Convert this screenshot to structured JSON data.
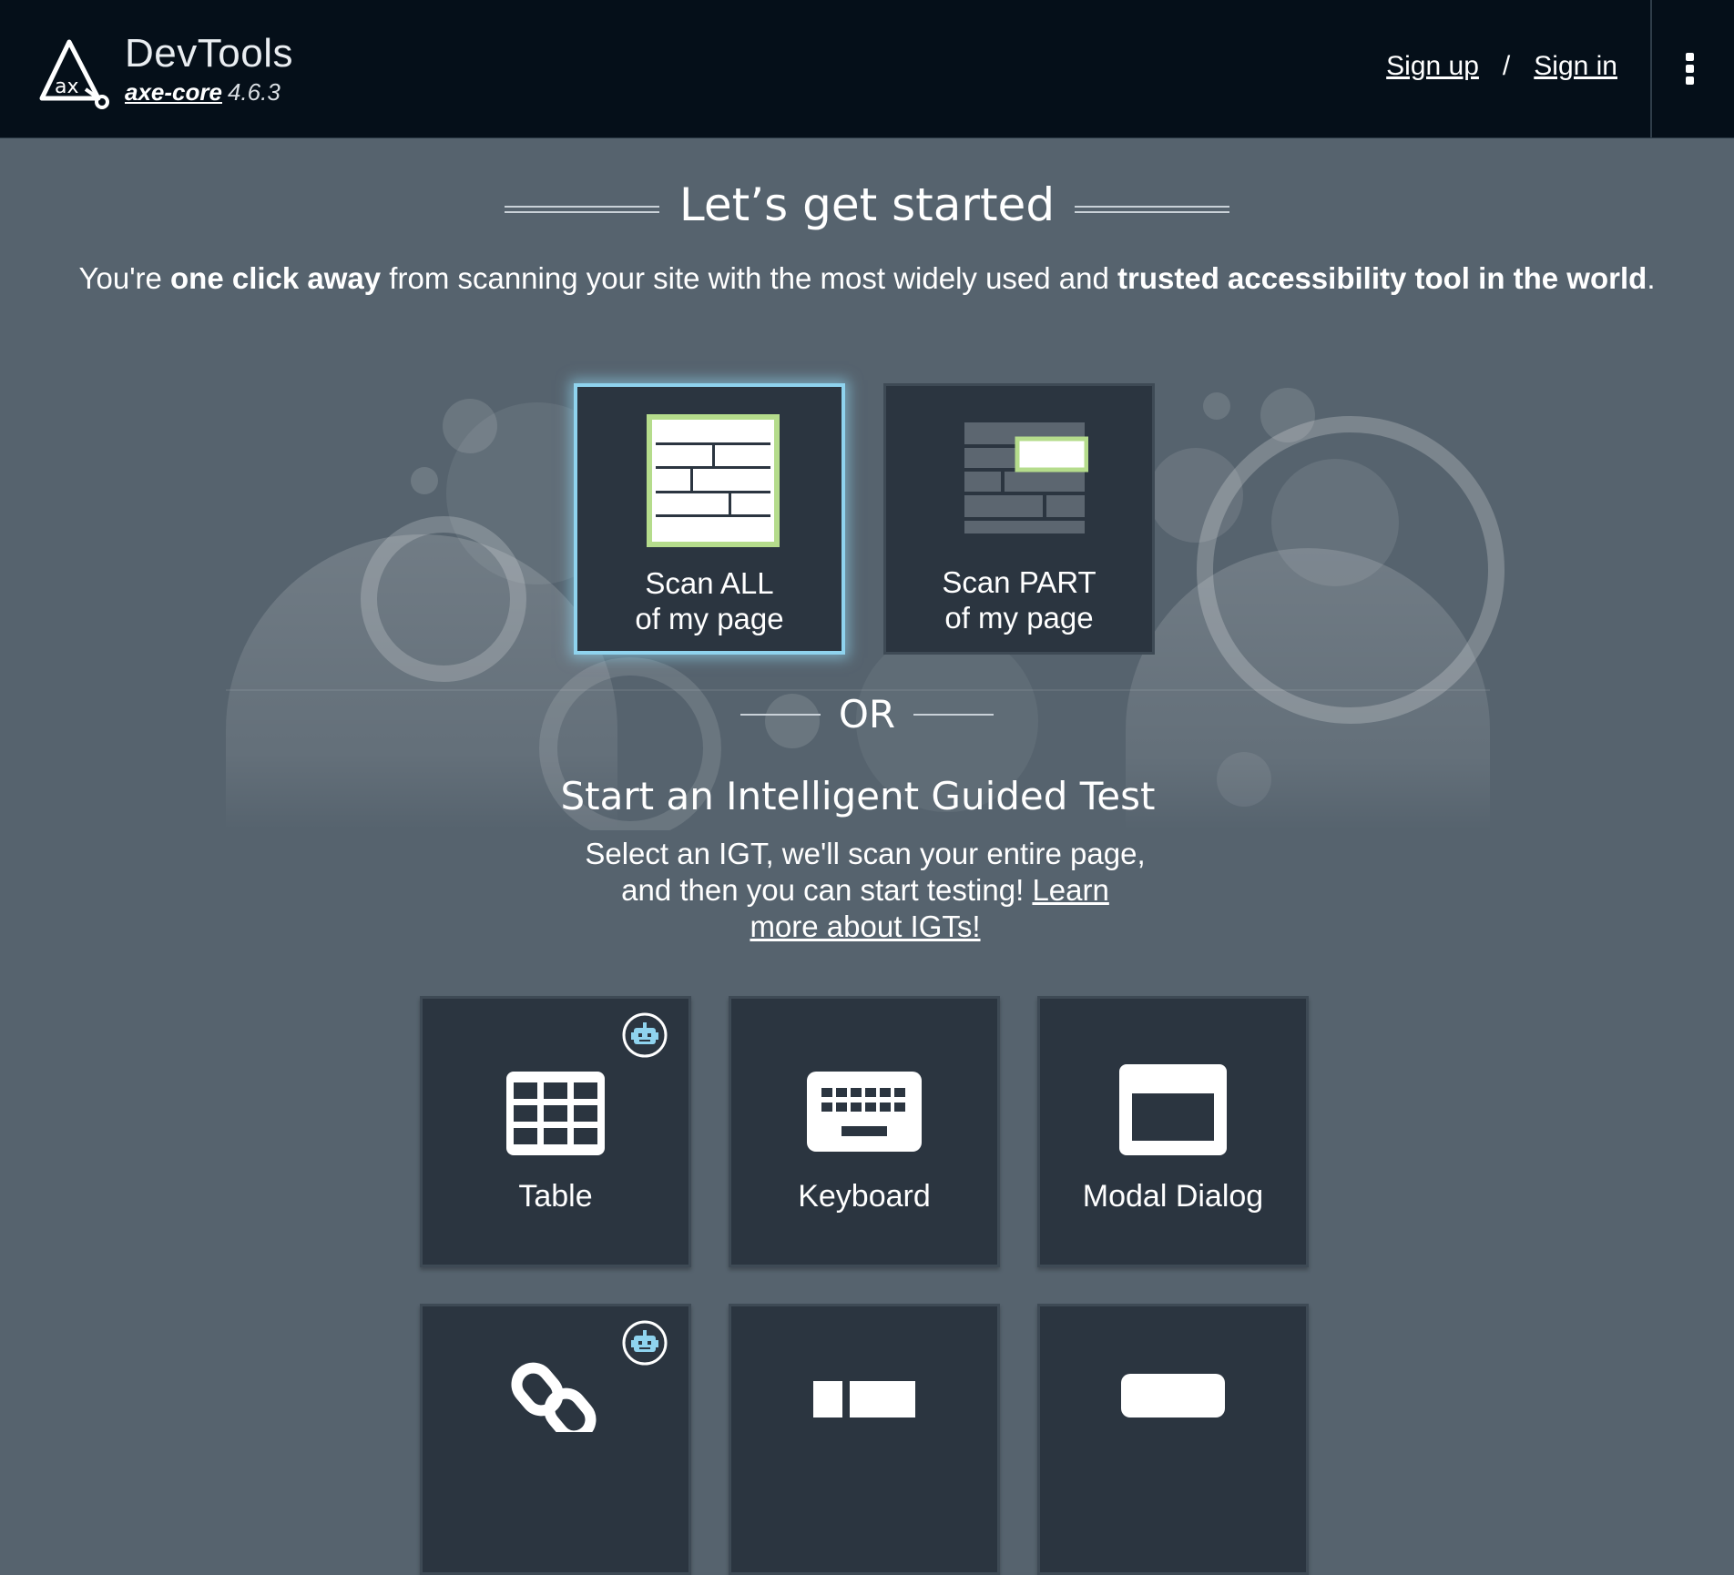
{
  "header": {
    "title": "DevTools",
    "core_name": "axe-core",
    "core_version": "4.6.3",
    "sign_up": "Sign up",
    "sign_in": "Sign in",
    "separator": "/"
  },
  "intro": {
    "heading": "Let’s get started",
    "p1": "You're ",
    "b1": "one click away",
    "p2": " from scanning your site with the most widely used and ",
    "b2": "trusted accessibility tool in the world",
    "p3": "."
  },
  "scan": {
    "all_line1": "Scan ALL",
    "all_line2": "of my page",
    "part_line1": "Scan PART",
    "part_line2": "of my page"
  },
  "or_text": "OR",
  "igt": {
    "title": "Start an Intelligent Guided Test",
    "desc": "Select an IGT, we'll scan your entire page, and then you can start testing! ",
    "learn_more": "Learn more about IGTs!",
    "cards": [
      {
        "label": "Table",
        "icon": "table-icon",
        "robot": true
      },
      {
        "label": "Keyboard",
        "icon": "keyboard-icon",
        "robot": false
      },
      {
        "label": "Modal Dialog",
        "icon": "modal-dialog-icon",
        "robot": false
      },
      {
        "label": "",
        "icon": "link-icon",
        "robot": true
      },
      {
        "label": "",
        "icon": "structure-icon",
        "robot": false
      },
      {
        "label": "",
        "icon": "form-icon",
        "robot": false
      }
    ]
  },
  "colors": {
    "header_bg": "#050f19",
    "page_bg": "#56636e",
    "card_bg": "#2b3540",
    "accent_green": "#b5dc8c",
    "accent_blue": "#8fd3ee"
  }
}
